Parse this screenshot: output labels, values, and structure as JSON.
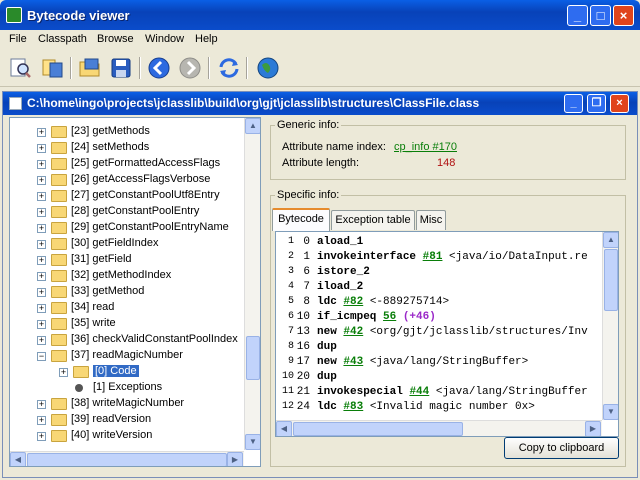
{
  "window": {
    "title": "Bytecode viewer"
  },
  "menu": [
    "File",
    "Classpath",
    "Browse",
    "Window",
    "Help"
  ],
  "toolbar": {
    "icons": [
      "open-file-icon",
      "browse-classpath-icon",
      "open-folder-icon",
      "save-icon",
      "back-icon",
      "forward-icon",
      "reload-icon",
      "web-icon"
    ],
    "accent": "#0a4ccb"
  },
  "inner_window": {
    "title": "C:\\home\\ingo\\projects\\jclasslib\\build\\org\\gjt\\jclasslib\\structures\\ClassFile.class"
  },
  "tree": {
    "items": [
      {
        "label": "[23] getMethods",
        "expandable": true
      },
      {
        "label": "[24] setMethods",
        "expandable": true
      },
      {
        "label": "[25] getFormattedAccessFlags",
        "expandable": true
      },
      {
        "label": "[26] getAccessFlagsVerbose",
        "expandable": true
      },
      {
        "label": "[27] getConstantPoolUtf8Entry",
        "expandable": true
      },
      {
        "label": "[28] getConstantPoolEntry",
        "expandable": true
      },
      {
        "label": "[29] getConstantPoolEntryName",
        "expandable": true
      },
      {
        "label": "[30] getFieldIndex",
        "expandable": true
      },
      {
        "label": "[31] getField",
        "expandable": true
      },
      {
        "label": "[32] getMethodIndex",
        "expandable": true
      },
      {
        "label": "[33] getMethod",
        "expandable": true
      },
      {
        "label": "[34] read",
        "expandable": true
      },
      {
        "label": "[35] write",
        "expandable": true
      },
      {
        "label": "[36] checkValidConstantPoolIndex",
        "expandable": true
      },
      {
        "label": "[37] readMagicNumber",
        "expandable": true,
        "expanded": true
      },
      {
        "label": "[0] Code",
        "expandable": true,
        "child": true,
        "selected": true
      },
      {
        "label": "[1] Exceptions",
        "expandable": false,
        "child": true
      },
      {
        "label": "[38] writeMagicNumber",
        "expandable": true
      },
      {
        "label": "[39] readVersion",
        "expandable": true
      },
      {
        "label": "[40] writeVersion",
        "expandable": true
      }
    ]
  },
  "generic_info": {
    "title": "Generic info:",
    "name_index_label": "Attribute name index:",
    "name_index_value": "cp_info #170",
    "length_label": "Attribute length:",
    "length_value": "148"
  },
  "specific_info": {
    "title": "Specific info:",
    "tabs": [
      "Bytecode",
      "Exception table",
      "Misc"
    ]
  },
  "bytecode": [
    {
      "ln": "1",
      "off": "0",
      "op": "aload_1",
      "ref": "",
      "rest": ""
    },
    {
      "ln": "2",
      "off": "1",
      "op": "invokeinterface",
      "ref": "#81",
      "rest": " <java/io/DataInput.re"
    },
    {
      "ln": "3",
      "off": "6",
      "op": "istore_2",
      "ref": "",
      "rest": ""
    },
    {
      "ln": "4",
      "off": "7",
      "op": "iload_2",
      "ref": "",
      "rest": ""
    },
    {
      "ln": "5",
      "off": "8",
      "op": "ldc",
      "ref": "#82",
      "rest": " <-889275714>"
    },
    {
      "ln": "6",
      "off": "10",
      "op": "if_icmpeq",
      "ref": "56",
      "rest": " (+46)"
    },
    {
      "ln": "7",
      "off": "13",
      "op": "new",
      "ref": "#42",
      "rest": " <org/gjt/jclasslib/structures/Inv"
    },
    {
      "ln": "8",
      "off": "16",
      "op": "dup",
      "ref": "",
      "rest": ""
    },
    {
      "ln": "9",
      "off": "17",
      "op": "new",
      "ref": "#43",
      "rest": " <java/lang/StringBuffer>"
    },
    {
      "ln": "10",
      "off": "20",
      "op": "dup",
      "ref": "",
      "rest": ""
    },
    {
      "ln": "11",
      "off": "21",
      "op": "invokespecial",
      "ref": "#44",
      "rest": " <java/lang/StringBuffer"
    },
    {
      "ln": "12",
      "off": "24",
      "op": "ldc",
      "ref": "#83",
      "rest": " <Invalid magic number 0x>"
    }
  ],
  "copy_button": "Copy to clipboard"
}
